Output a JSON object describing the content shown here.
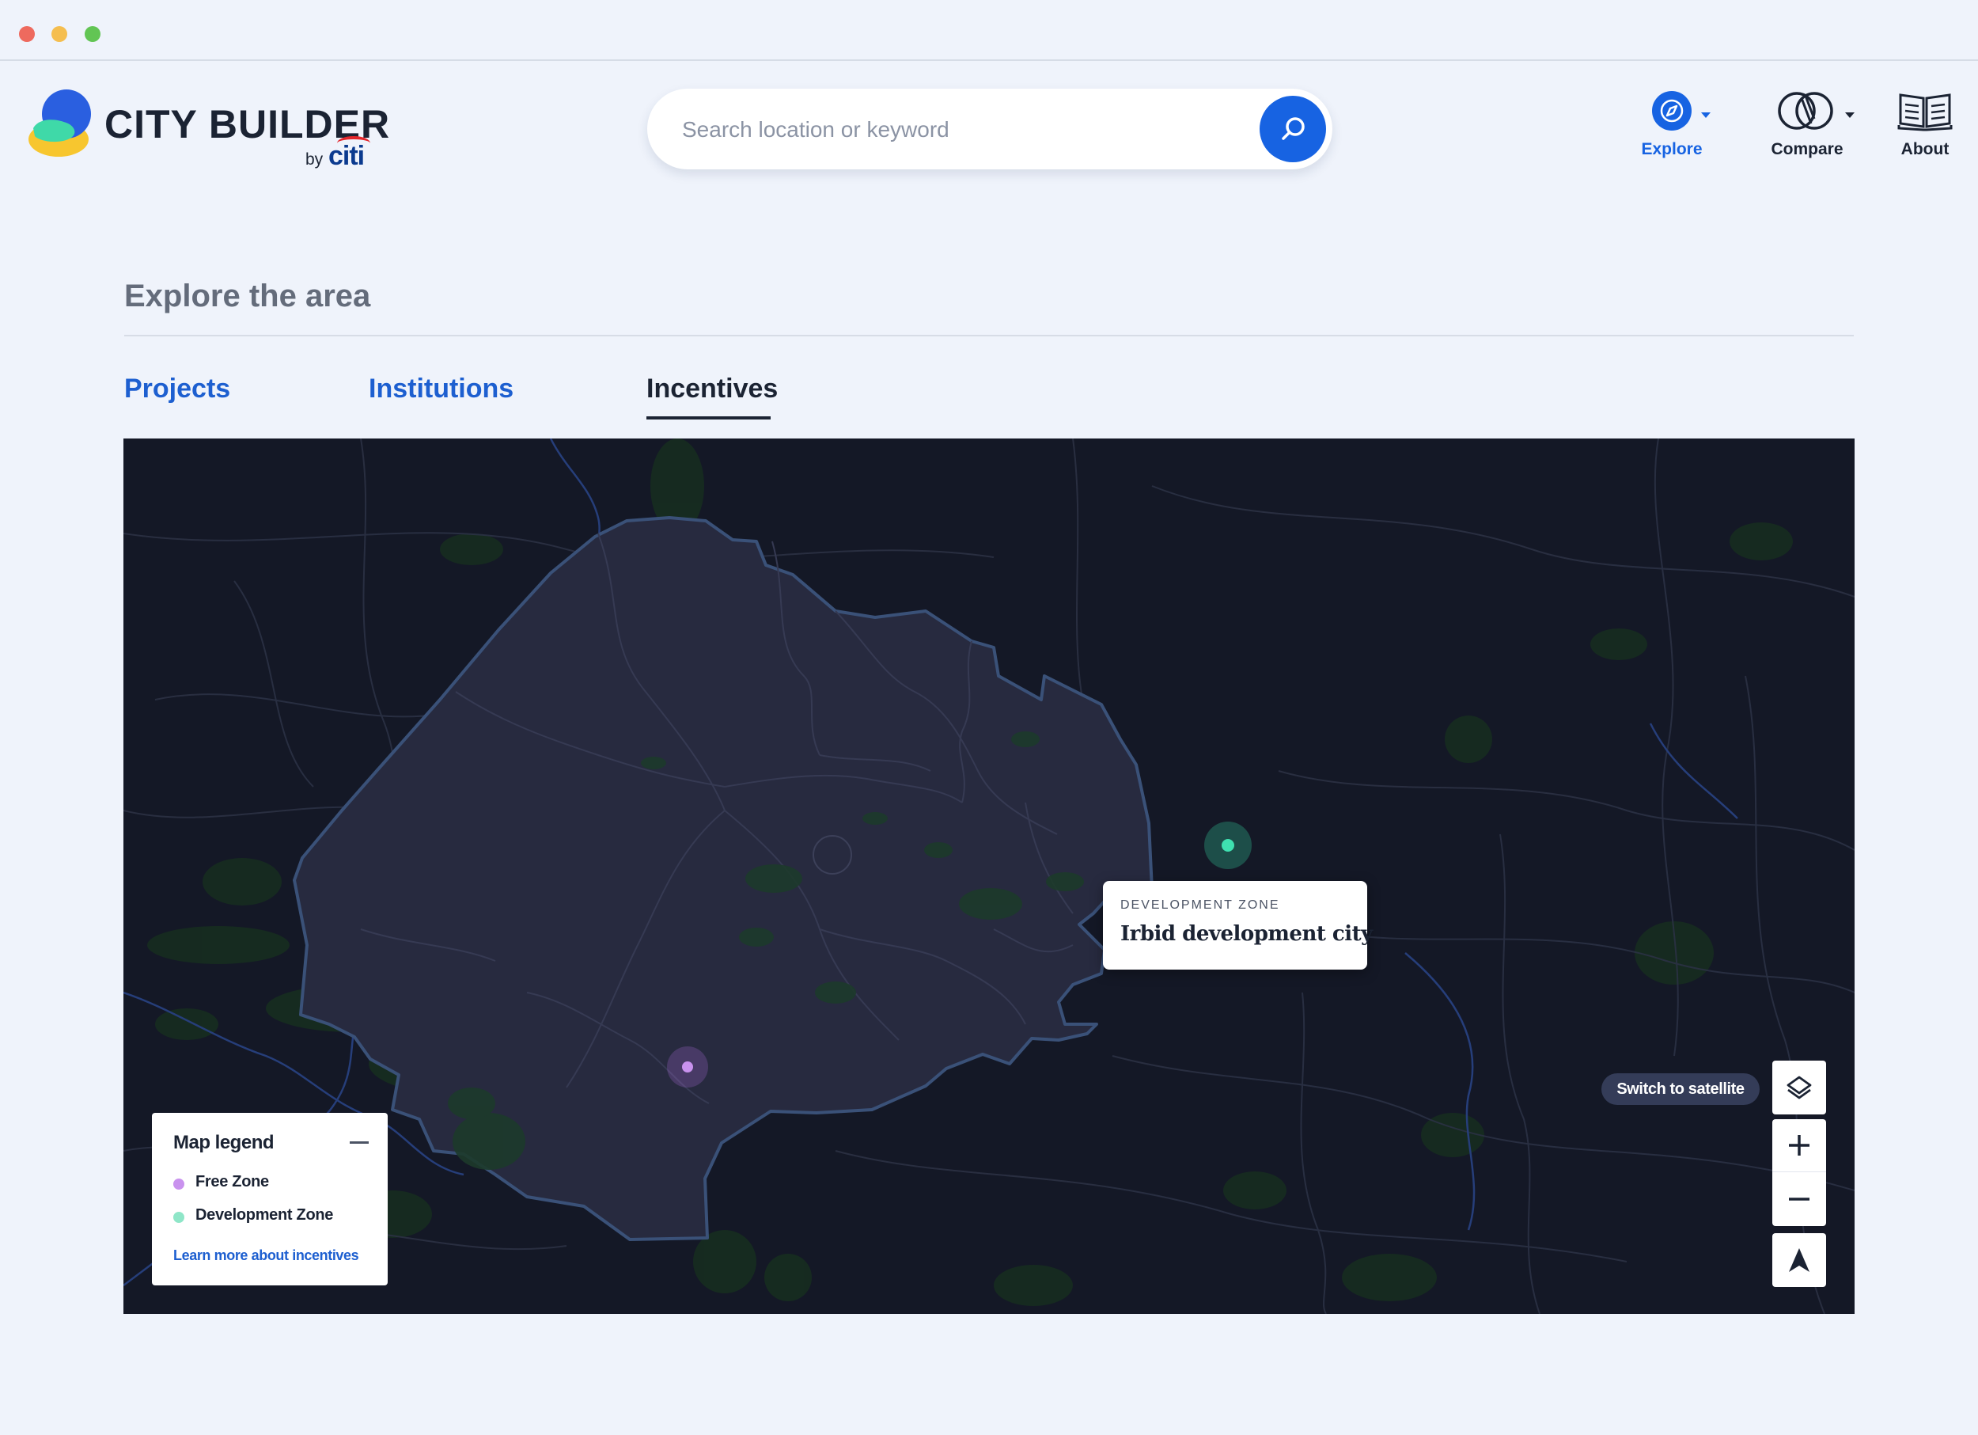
{
  "brand": {
    "name": "CITY BUILDER",
    "by": "by",
    "partner": "citi"
  },
  "search": {
    "placeholder": "Search location or keyword",
    "value": ""
  },
  "nav": [
    {
      "label": "Explore",
      "icon": "compass-icon",
      "active": true
    },
    {
      "label": "Compare",
      "icon": "compare-icon",
      "active": false
    },
    {
      "label": "About",
      "icon": "book-icon",
      "active": false
    }
  ],
  "page": {
    "title": "Explore the area"
  },
  "tabs": [
    {
      "label": "Projects",
      "active": false
    },
    {
      "label": "Institutions",
      "active": false
    },
    {
      "label": "Incentives",
      "active": true
    }
  ],
  "map": {
    "tooltip": {
      "kicker": "DEVELOPMENT ZONE",
      "title": "Irbid development city"
    },
    "legend": {
      "title": "Map legend",
      "items": [
        {
          "label": "Free Zone",
          "color": "#c992ee"
        },
        {
          "label": "Development Zone",
          "color": "#3fe0b0"
        }
      ],
      "link": "Learn more about incentives"
    },
    "controls": {
      "satellite_label": "Switch to satellite"
    }
  },
  "colors": {
    "accent": "#1763e2",
    "map_bg": "#141826",
    "region_fill": "#272a3f",
    "region_border": "#3a5178"
  }
}
